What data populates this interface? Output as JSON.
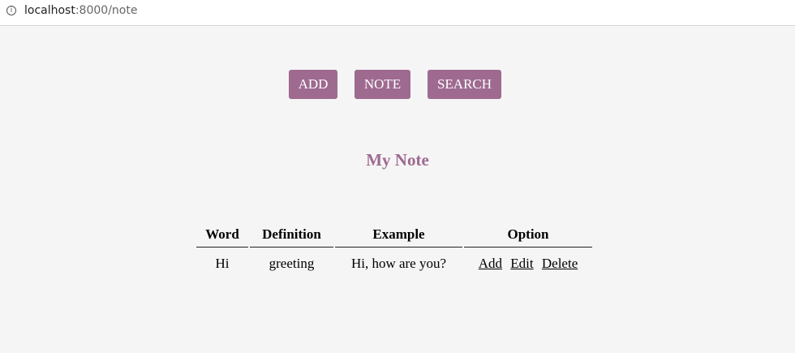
{
  "browser": {
    "url_host": "localhost",
    "url_rest": ":8000/note",
    "info_icon": "info-circle-icon"
  },
  "nav": {
    "add_label": "ADD",
    "note_label": "NOTE",
    "search_label": "SEARCH"
  },
  "page": {
    "title": "My Note"
  },
  "colors": {
    "accent": "#9e6a90",
    "background": "#f5f5f5"
  },
  "table": {
    "headers": [
      "Word",
      "Definition",
      "Example",
      "Option"
    ],
    "rows": [
      {
        "word": "Hi",
        "definition": "greeting",
        "example": "Hi, how are you?",
        "options": [
          "Add",
          "Edit",
          "Delete"
        ]
      }
    ]
  }
}
